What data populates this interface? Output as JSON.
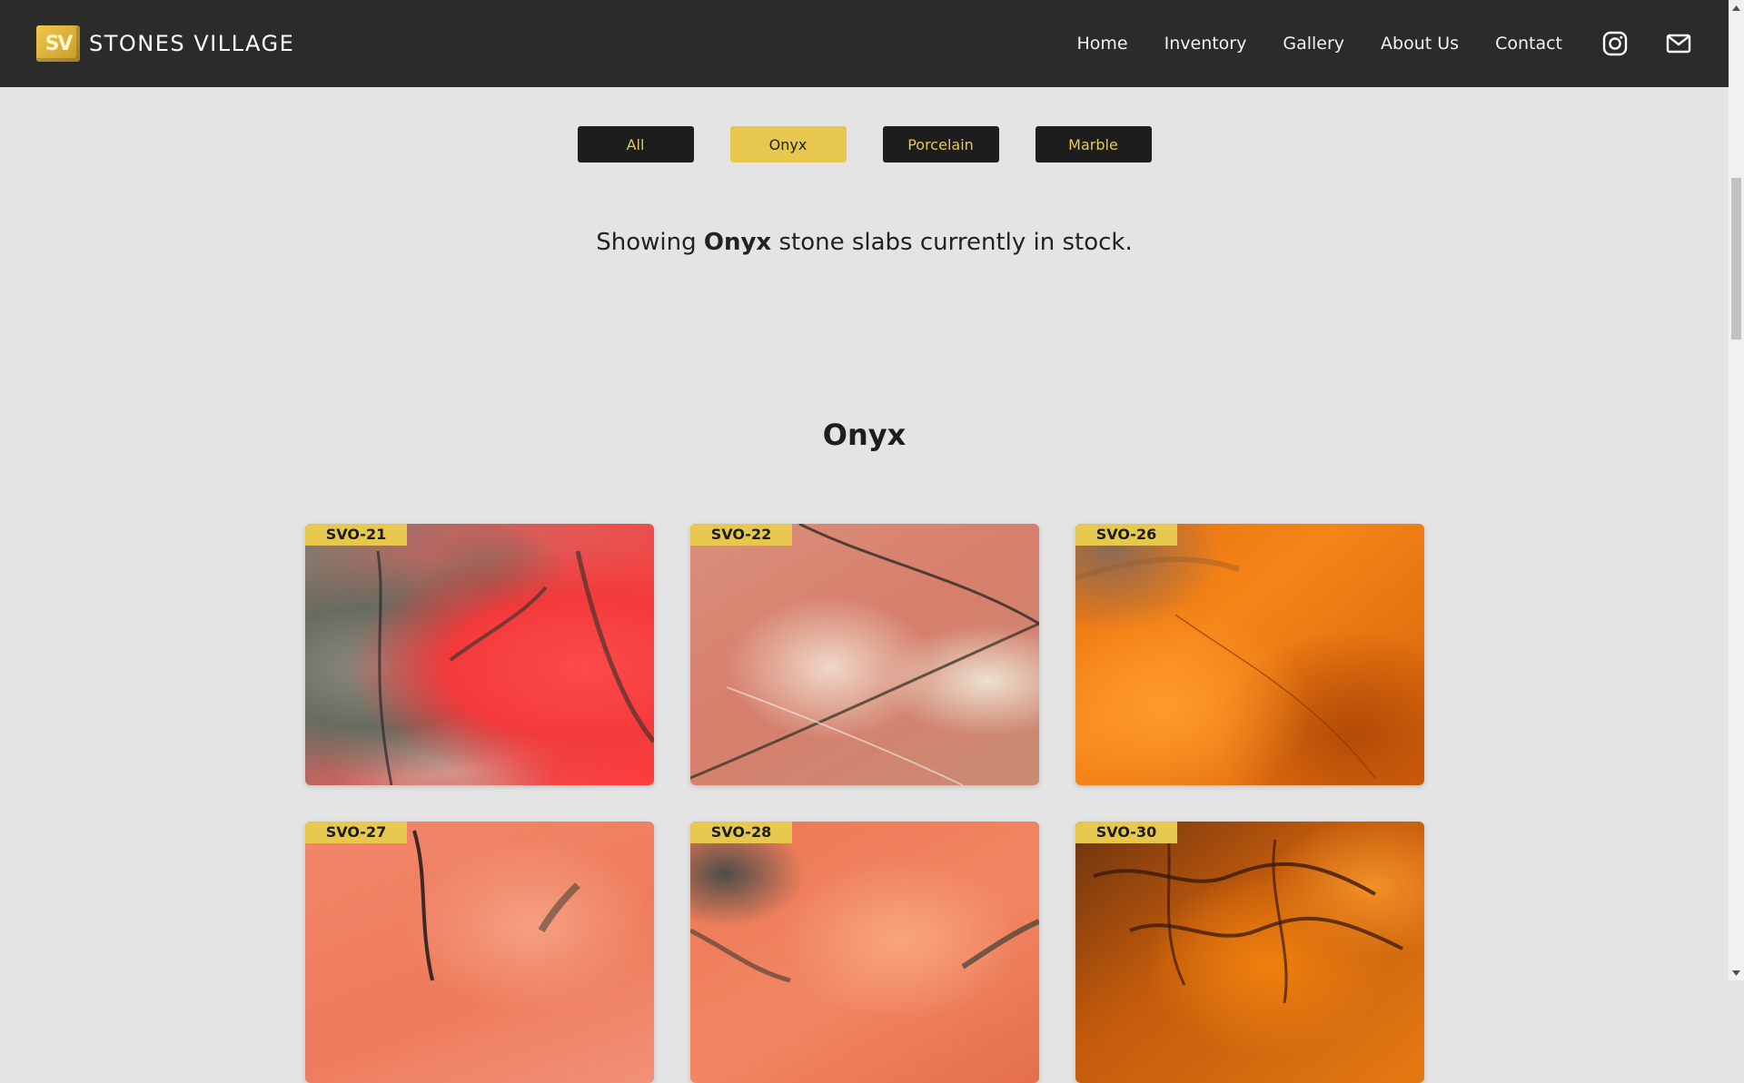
{
  "header": {
    "logo_text": "SV",
    "brand_name": "STONES VILLAGE",
    "nav": [
      {
        "label": "Home"
      },
      {
        "label": "Inventory"
      },
      {
        "label": "Gallery"
      },
      {
        "label": "About Us"
      },
      {
        "label": "Contact"
      }
    ],
    "icons": [
      "instagram-icon",
      "mail-icon"
    ]
  },
  "filters": {
    "items": [
      {
        "label": "All",
        "active": false
      },
      {
        "label": "Onyx",
        "active": true
      },
      {
        "label": "Porcelain",
        "active": false
      },
      {
        "label": "Marble",
        "active": false
      }
    ]
  },
  "status": {
    "prefix": "Showing ",
    "category": "Onyx",
    "suffix": " stone slabs currently in stock."
  },
  "section": {
    "title": "Onyx",
    "slabs": [
      {
        "code": "SVO-21"
      },
      {
        "code": "SVO-22"
      },
      {
        "code": "SVO-26"
      },
      {
        "code": "SVO-27"
      },
      {
        "code": "SVO-28"
      },
      {
        "code": "SVO-30"
      }
    ]
  },
  "colors": {
    "header_bg": "#2b2b2b",
    "page_bg": "#e4e4e4",
    "accent": "#e8c74f",
    "button_dark": "#1d1d1d"
  }
}
